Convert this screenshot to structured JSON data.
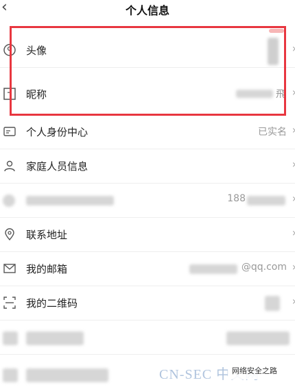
{
  "header": {
    "title": "个人信息",
    "back_icon": "chevron-left-icon"
  },
  "rows": [
    {
      "label": "头像",
      "value": "",
      "icon": "avatar-circle-icon"
    },
    {
      "label": "昵称",
      "value": "飛",
      "icon": "nickname-card-icon"
    },
    {
      "label": "个人身份中心",
      "value": "已实名",
      "icon": "id-card-icon"
    },
    {
      "label": "家庭人员信息",
      "value": "",
      "icon": "person-icon"
    },
    {
      "label": "",
      "value": "188",
      "icon": "blurred-icon"
    },
    {
      "label": "联系地址",
      "value": "",
      "icon": "location-pin-icon"
    },
    {
      "label": "我的邮箱",
      "value": "@qq.com",
      "icon": "mail-icon"
    },
    {
      "label": "我的二维码",
      "value": "",
      "icon": "qr-scan-icon"
    }
  ],
  "colors": {
    "highlight": "#e8363f",
    "watermark": "#b0c4de"
  },
  "watermark": {
    "text": "CN-SEC 中文网",
    "badge": "网络安全之路"
  }
}
